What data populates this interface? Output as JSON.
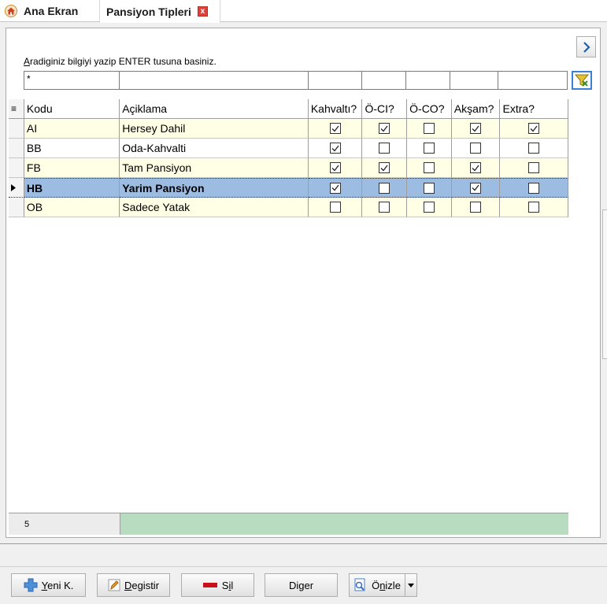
{
  "tabs": [
    {
      "label": "Ana Ekran",
      "icon": "home-icon"
    },
    {
      "label": "Pansiyon Tipleri",
      "close": "x"
    }
  ],
  "search": {
    "hint_underlined": "A",
    "hint_rest": "radiginiz bilgiyi yazip ENTER tusuna basiniz.",
    "filter_value": "*"
  },
  "grid": {
    "columns": [
      "Kodu",
      "Açiklama",
      "Kahvaltı?",
      "Ö-CI?",
      "Ö-CO?",
      "Akşam?",
      "Extra?"
    ],
    "rows": [
      {
        "kod": "AI",
        "acik": "Hersey Dahil",
        "kah": true,
        "oci": true,
        "oco": false,
        "aks": true,
        "ext": true
      },
      {
        "kod": "BB",
        "acik": "Oda-Kahvalti",
        "kah": true,
        "oci": false,
        "oco": false,
        "aks": false,
        "ext": false
      },
      {
        "kod": "FB",
        "acik": "Tam Pansiyon",
        "kah": true,
        "oci": true,
        "oco": false,
        "aks": true,
        "ext": false
      },
      {
        "kod": "HB",
        "acik": "Yarim Pansiyon",
        "kah": true,
        "oci": false,
        "oco": false,
        "aks": true,
        "ext": false,
        "selected": true
      },
      {
        "kod": "OB",
        "acik": "Sadece Yatak",
        "kah": false,
        "oci": false,
        "oco": false,
        "aks": false,
        "ext": false
      }
    ],
    "record_count": "5"
  },
  "buttons": {
    "new": {
      "underlined": "Y",
      "rest": "eni K."
    },
    "edit": {
      "underlined": "D",
      "rest": "egistir"
    },
    "delete": {
      "pre": "S",
      "underlined": "i",
      "rest": "l"
    },
    "other": {
      "pre": "Di",
      "underlined": "g",
      "rest": "er"
    },
    "preview": {
      "pre": "Ö",
      "underlined": "n",
      "rest": "izle"
    }
  }
}
